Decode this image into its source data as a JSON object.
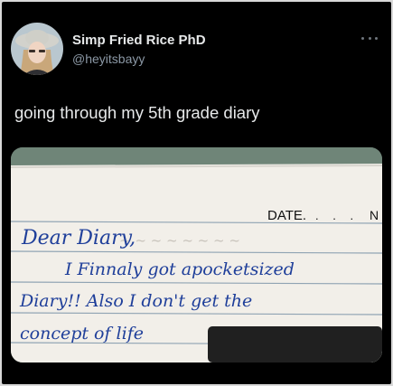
{
  "tweet": {
    "display_name": "Simp Fried Rice PhD",
    "handle": "@heyitsbayy",
    "text": "going through my 5th grade diary",
    "more_icon": "ellipsis-icon",
    "avatar_icon": "avatar"
  },
  "diary_page": {
    "header_date": "DATE.",
    "header_no": "N",
    "lines": [
      "Dear Diary,",
      "I Finnaly got apocketsized",
      "Diary!! Also I don't get the",
      "concept of life"
    ]
  },
  "colors": {
    "background": "#000000",
    "name": "#e7e9ea",
    "handle": "#8b98a5",
    "ink": "#1f3f9a",
    "paper": "#f2efe9"
  }
}
